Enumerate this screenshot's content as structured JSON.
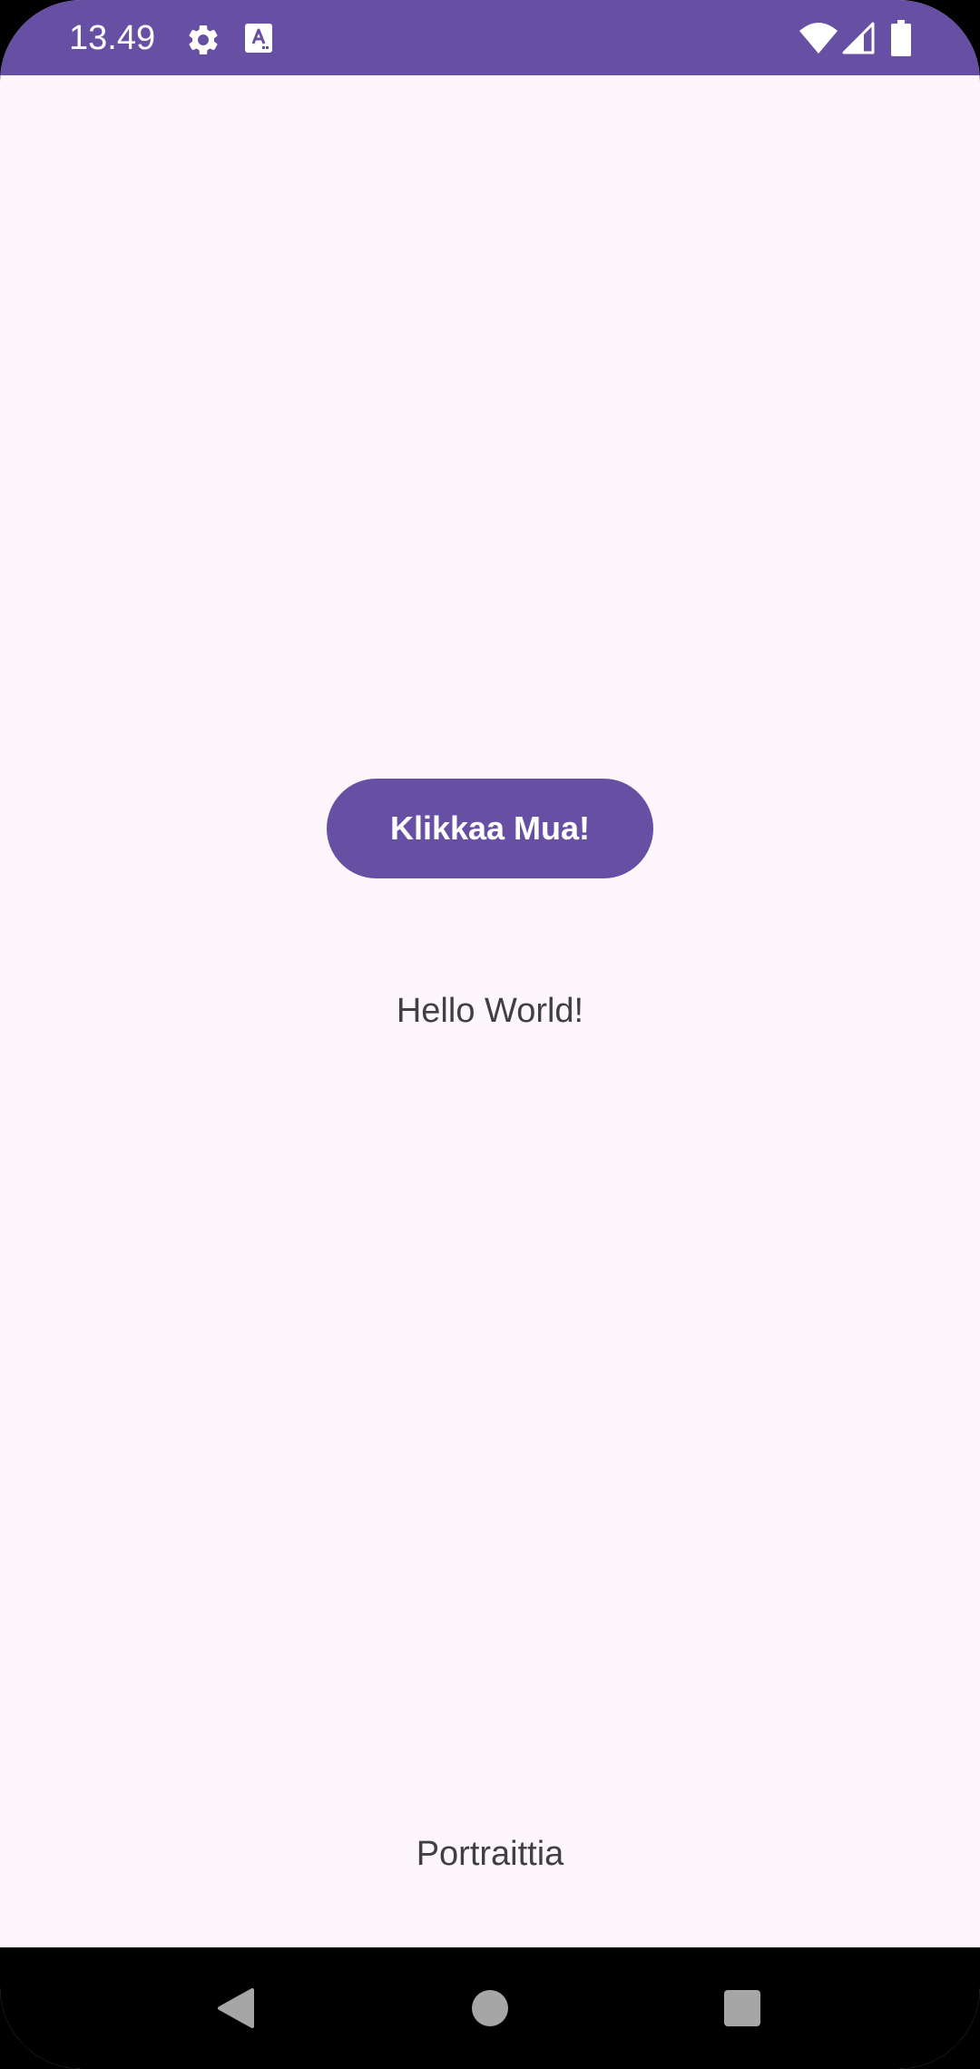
{
  "status_bar": {
    "time": "13.49",
    "background_color": "#6750A4",
    "left_icons": [
      "gear-icon",
      "keyboard-a-icon"
    ],
    "right_icons": [
      "wifi-icon",
      "cellular-signal-icon",
      "battery-icon"
    ]
  },
  "main": {
    "button_label": "Klikkaa Mua!",
    "hello_text": "Hello World!",
    "orientation_text": "Portraittia",
    "accent_color": "#6750A4",
    "background_color": "#FDF7FB"
  },
  "nav_bar": {
    "buttons": [
      "back-icon",
      "home-icon",
      "recents-icon"
    ]
  }
}
